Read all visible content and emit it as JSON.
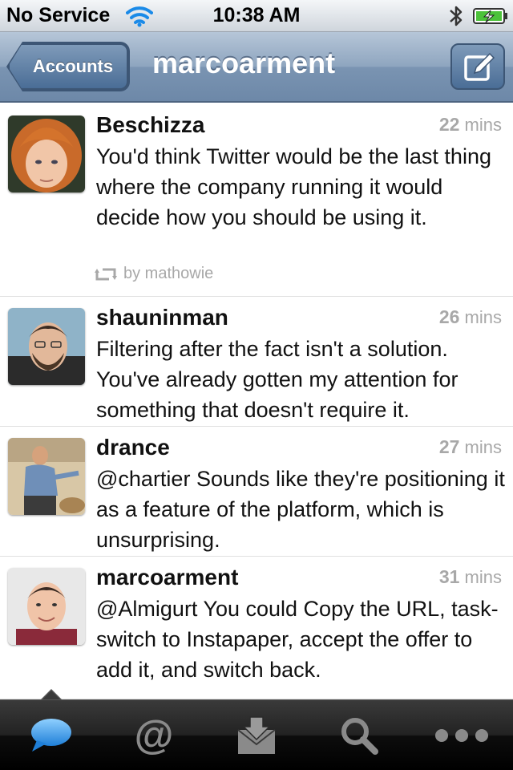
{
  "status_bar": {
    "carrier": "No Service",
    "time": "10:38 AM",
    "icons": [
      "wifi-icon",
      "bluetooth-icon",
      "battery-charging-icon"
    ]
  },
  "nav": {
    "back_label": "Accounts",
    "title": "marcoarment",
    "compose_icon": "compose-icon"
  },
  "tweets": [
    {
      "user": "Beschizza",
      "time_num": "22",
      "time_unit": " mins",
      "text": "You'd think Twitter would be the last thing where the company running it would decide how you should be using it.",
      "retweet": "by mathowie"
    },
    {
      "user": "shauninman",
      "time_num": "26",
      "time_unit": " mins",
      "text": "Filtering after the fact isn't a solution. You've already gotten my attention for something that doesn't require it."
    },
    {
      "user": "drance",
      "time_num": "27",
      "time_unit": " mins",
      "text": "@chartier Sounds like they're positioning it as a feature of the platform, which is unsurprising."
    },
    {
      "user": "marcoarment",
      "time_num": "31",
      "time_unit": " mins",
      "text": "@Almigurt You could Copy the URL, task-switch to Instapaper, accept the offer to add it, and switch back."
    }
  ],
  "tab_bar": {
    "items": [
      "timeline-icon",
      "mentions-icon",
      "messages-icon",
      "search-icon",
      "more-icon"
    ],
    "selected": "timeline-icon"
  },
  "colors": {
    "nav_blue": "#7a94b2",
    "time_gray": "#a8a8a8",
    "tab_selected_blue": "#3aa0f0"
  }
}
